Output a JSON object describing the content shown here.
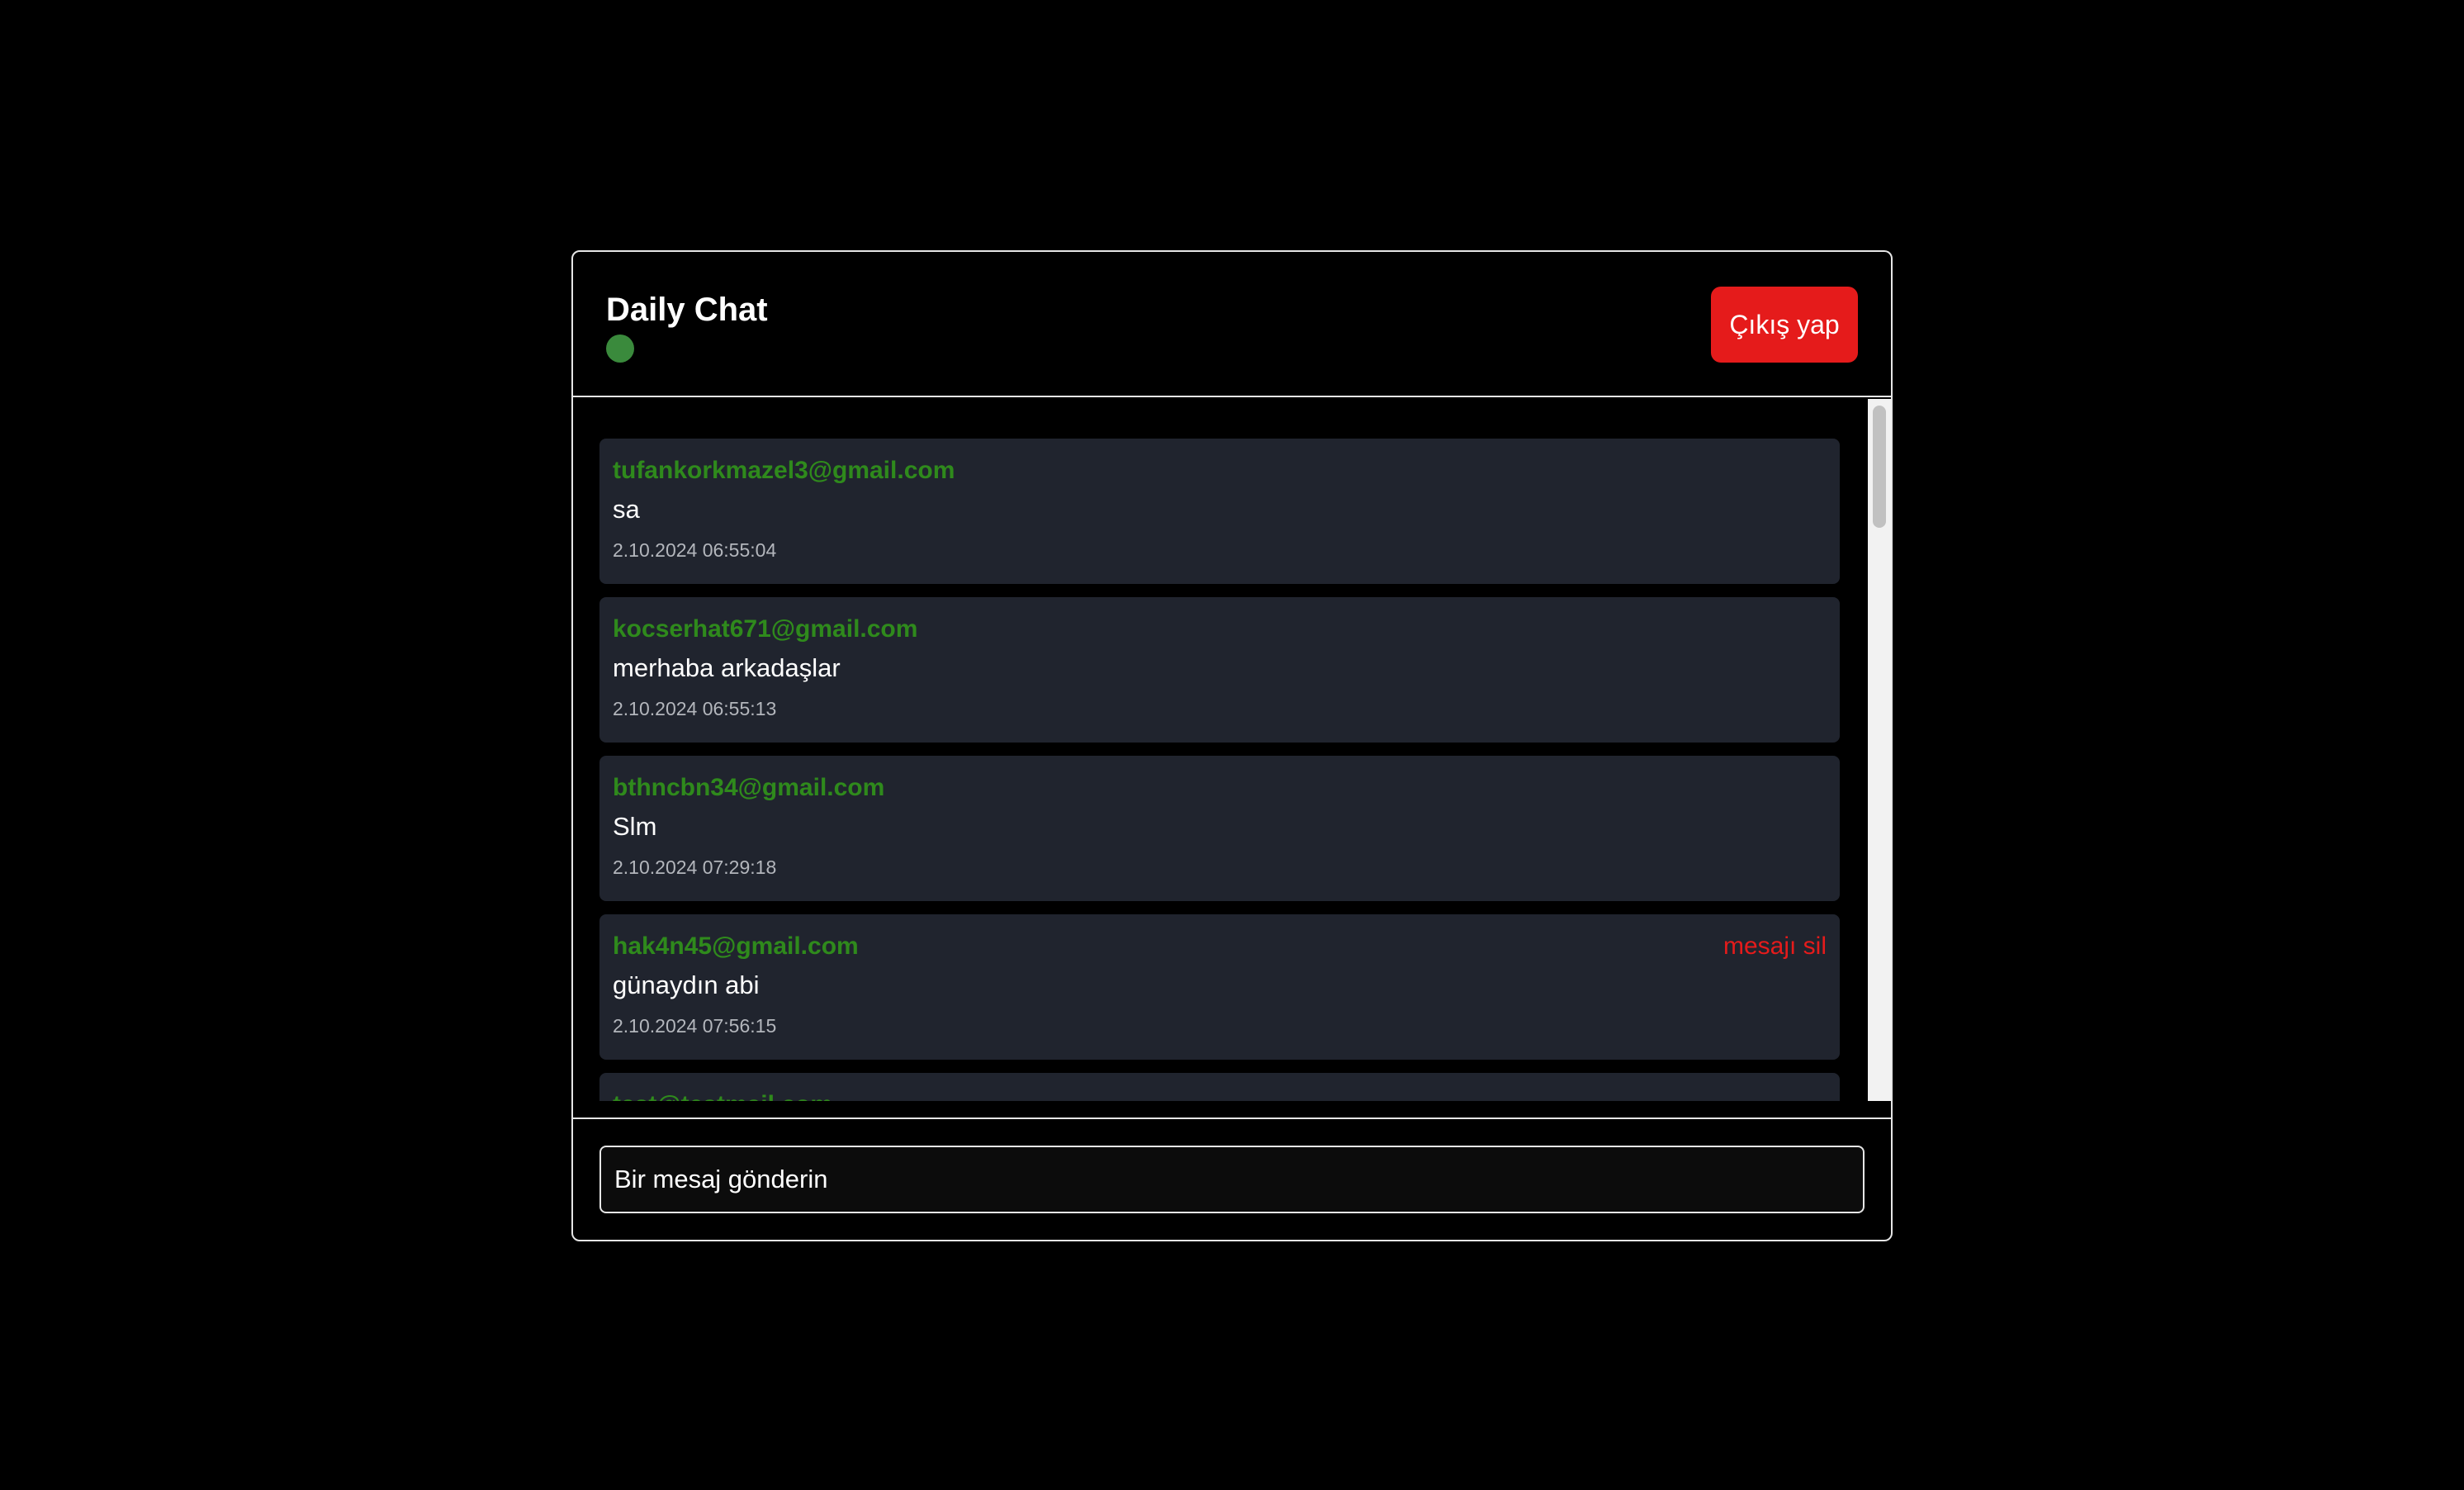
{
  "header": {
    "title": "Daily Chat",
    "status_color": "#3a8a3c",
    "logout_label": "Çıkış yap"
  },
  "messages": [
    {
      "author": "tufankorkmazel3@gmail.com",
      "text": "sa",
      "time": "2.10.2024 06:55:04",
      "can_delete": false
    },
    {
      "author": "kocserhat671@gmail.com",
      "text": "merhaba arkadaşlar",
      "time": "2.10.2024 06:55:13",
      "can_delete": false
    },
    {
      "author": "bthncbn34@gmail.com",
      "text": "Slm",
      "time": "2.10.2024 07:29:18",
      "can_delete": false
    },
    {
      "author": "hak4n45@gmail.com",
      "text": "günaydın abi",
      "time": "2.10.2024 07:56:15",
      "can_delete": true,
      "delete_label": "mesajı sil"
    },
    {
      "author": "test@testmail.com",
      "text": "",
      "time": "",
      "can_delete": false
    }
  ],
  "composer": {
    "placeholder": "Bir mesaj gönderin"
  },
  "colors": {
    "background": "#000000",
    "message_bg": "#20242e",
    "author": "#2f8a1c",
    "delete": "#e51b1b",
    "logout": "#e51b1b"
  }
}
